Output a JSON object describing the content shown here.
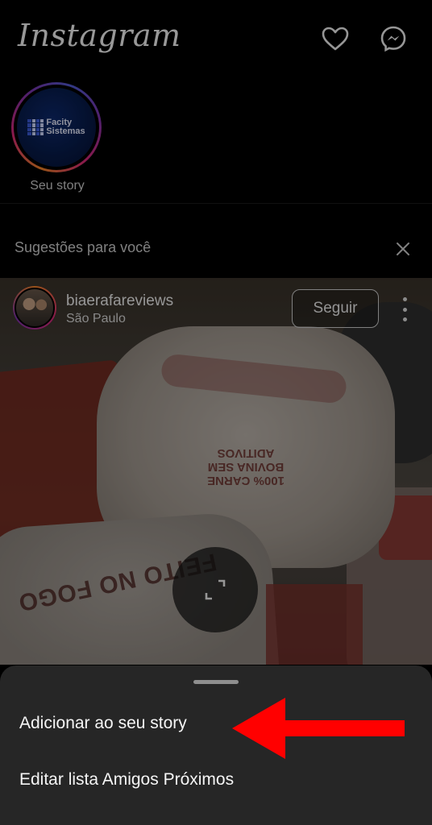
{
  "header": {
    "logo_text": "Instagram",
    "icons": [
      "heart-icon",
      "messenger-icon"
    ]
  },
  "stories": {
    "items": [
      {
        "label": "Seu story",
        "avatar_text_line1": "Facity",
        "avatar_text_line2": "Sistemas"
      }
    ]
  },
  "suggestions": {
    "title": "Sugestões para você",
    "close_icon": "close-icon"
  },
  "post": {
    "username": "biaerafareviews",
    "location": "São Paulo",
    "follow_label": "Seguir",
    "image_text_stamp": "100% CARNE BOVINA SEM ADITIVOS",
    "image_text_wrapper": "FEITO NO FOGO"
  },
  "sheet": {
    "items": [
      {
        "label": "Adicionar ao seu story"
      },
      {
        "label": "Editar lista Amigos Próximos"
      }
    ]
  },
  "colors": {
    "background": "#000000",
    "sheet": "#262626",
    "annotation_arrow": "#ff0000"
  }
}
